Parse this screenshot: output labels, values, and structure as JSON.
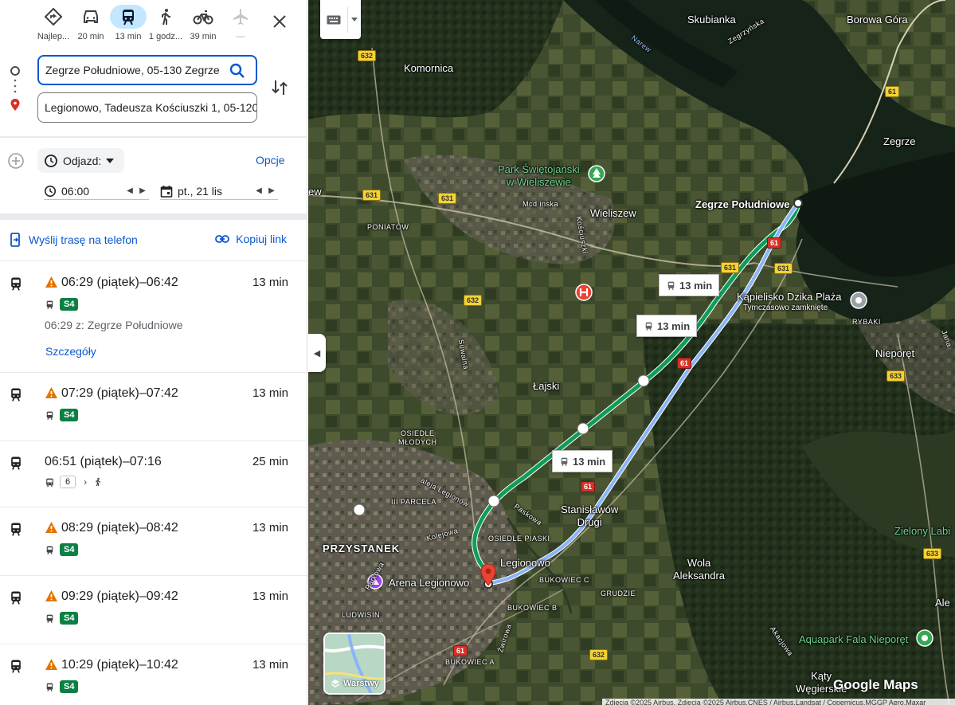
{
  "modes": [
    {
      "name": "best",
      "label": "Najlep..."
    },
    {
      "name": "car",
      "label": "20 min"
    },
    {
      "name": "transit",
      "label": "13 min"
    },
    {
      "name": "walk",
      "label": "1 godz..."
    },
    {
      "name": "bike",
      "label": "39 min"
    },
    {
      "name": "flight",
      "label": "—"
    }
  ],
  "origin": "Zegrze Południowe, 05-130 Zegrze",
  "destination": "Legionowo, Tadeusza Kościuszki 1, 05-120",
  "depart_label": "Odjazd:",
  "options_label": "Opcje",
  "time_value": "06:00",
  "date_value": "pt., 21 lis",
  "send_to_phone": "Wyślij trasę na telefon",
  "copy_link": "Kopiuj link",
  "routes": [
    {
      "times": "06:29 (piątek)–06:42",
      "duration": "13 min",
      "warning": true,
      "line": "S4",
      "sub": "06:29 z: Zegrze Południowe",
      "details": "Szczegóły"
    },
    {
      "times": "07:29 (piątek)–07:42",
      "duration": "13 min",
      "warning": true,
      "line": "S4"
    },
    {
      "times": "06:51 (piątek)–07:16",
      "duration": "25 min",
      "warning": false,
      "bus": "6"
    },
    {
      "times": "08:29 (piątek)–08:42",
      "duration": "13 min",
      "warning": true,
      "line": "S4"
    },
    {
      "times": "09:29 (piątek)–09:42",
      "duration": "13 min",
      "warning": true,
      "line": "S4"
    },
    {
      "times": "10:29 (piątek)–10:42",
      "duration": "13 min",
      "warning": true,
      "line": "S4"
    }
  ],
  "map": {
    "places": {
      "skubianka": "Skubianka",
      "borowa_gora": "Borowa Góra",
      "komornica": "Komornica",
      "narew": "Narew",
      "zegrze": "Zegrze",
      "zegrze_pld": "Zegrze Południowe",
      "park": "Park Świętojański\nw Wieliszewie",
      "mcd": "Mcd inska",
      "wieliszew": "Wieliszew",
      "poniatow": "PONIATÓW",
      "ew": "ew",
      "kapielisko": "Kąpielisko Dzika Plaża",
      "kapielisko_note": "Tymczasowo zamknięte",
      "rybaki": "RYBAKI",
      "nieporet": "Nieporęt",
      "lajski": "Łajski",
      "osiedle_mlodych": "OSIEDLE\nMŁODYCH",
      "iii_parcela": "III PARCELA",
      "stanislawow": "Stanisławów\nDrugi",
      "osiedle_piaski": "OSIEDLE PIASKI",
      "przystanek": "PRZYSTANEK",
      "legionowo": "Legionowo",
      "arena": "Arena Legionowo",
      "bukowiec_c": "BUKOWIEC C",
      "bukowiec_b": "BUKOWIEC B",
      "bukowiec_a": "BUKOWIEC A",
      "grudzie": "GRUDZIE",
      "ludwisin": "LUDWISIN",
      "wola": "Wola\nAleksandra",
      "zielony": "Zielony Labi",
      "aquapark": "Aquapark Fala Nieporęt",
      "katy": "Kąty\nWęgierskie",
      "ale": "Ale",
      "suwalna": "Suwalna",
      "kolejowa": "Kolejowa",
      "parkowa": "Parkowa",
      "zwirowa": "Żwirowa",
      "akacjowa": "Akacjowa",
      "kosciuszki": "Kościuszki",
      "legionow": "aleja Legionów",
      "zegrzynska": "Zegrzyńska",
      "paskowa": "Paskowa",
      "jana": "Jana"
    },
    "roads": [
      "632",
      "631",
      "61",
      "633"
    ],
    "route_labels": [
      "13 min",
      "13 min",
      "13 min"
    ],
    "layers_label": "Warstwy",
    "logo": "Google Maps",
    "attribution": "Zdjęcia ©2025 Airbus, Zdjęcia ©2025 Airbus,CNES / Airbus,Landsat / Copernicus,MGGP Aero,Maxar"
  }
}
